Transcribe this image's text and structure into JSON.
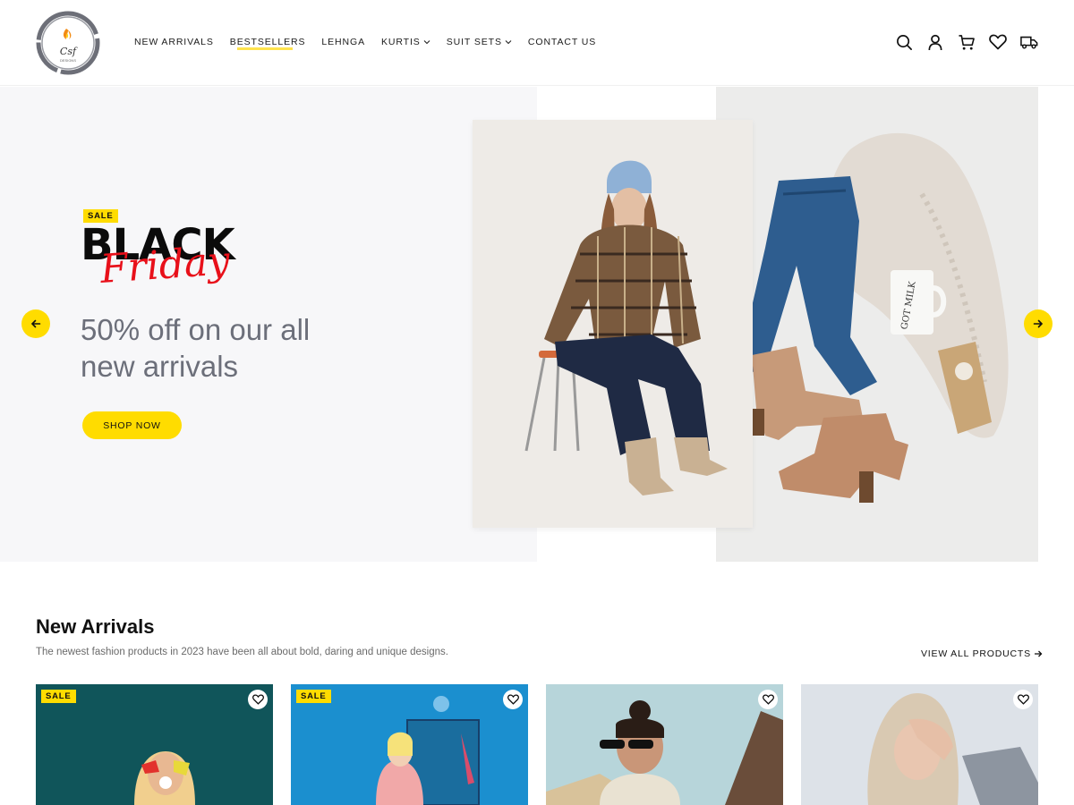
{
  "brand": {
    "logo_text": "Csf",
    "logo_subtext": "DESIGNS"
  },
  "nav": {
    "items": [
      {
        "label": "NEW ARRIVALS"
      },
      {
        "label": "BESTSELLERS"
      },
      {
        "label": "LEHNGA"
      },
      {
        "label": "KURTIS"
      },
      {
        "label": "SUIT SETS"
      },
      {
        "label": "CONTACT US"
      }
    ]
  },
  "header_icons": [
    "search-icon",
    "user-icon",
    "cart-icon",
    "heart-icon",
    "truck-icon"
  ],
  "hero": {
    "sale_tag": "SALE",
    "title_main": "BLACK",
    "title_script": "Friday",
    "subtitle": "50% off on our all new arrivals",
    "cta": "SHOP NOW",
    "mug_text": "GOT MILK"
  },
  "colors": {
    "accent": "#ffdc00",
    "script_red": "#e8101a",
    "subtitle_gray": "#6c6f7a"
  },
  "new_arrivals": {
    "title": "New Arrivals",
    "description": "The newest fashion products in 2023 have been all about bold, daring and unique designs.",
    "view_all": "VIEW ALL PRODUCTS",
    "products": [
      {
        "sale_label": "SALE"
      },
      {
        "sale_label": "SALE"
      },
      {
        "sale_label": ""
      },
      {
        "sale_label": ""
      }
    ]
  }
}
